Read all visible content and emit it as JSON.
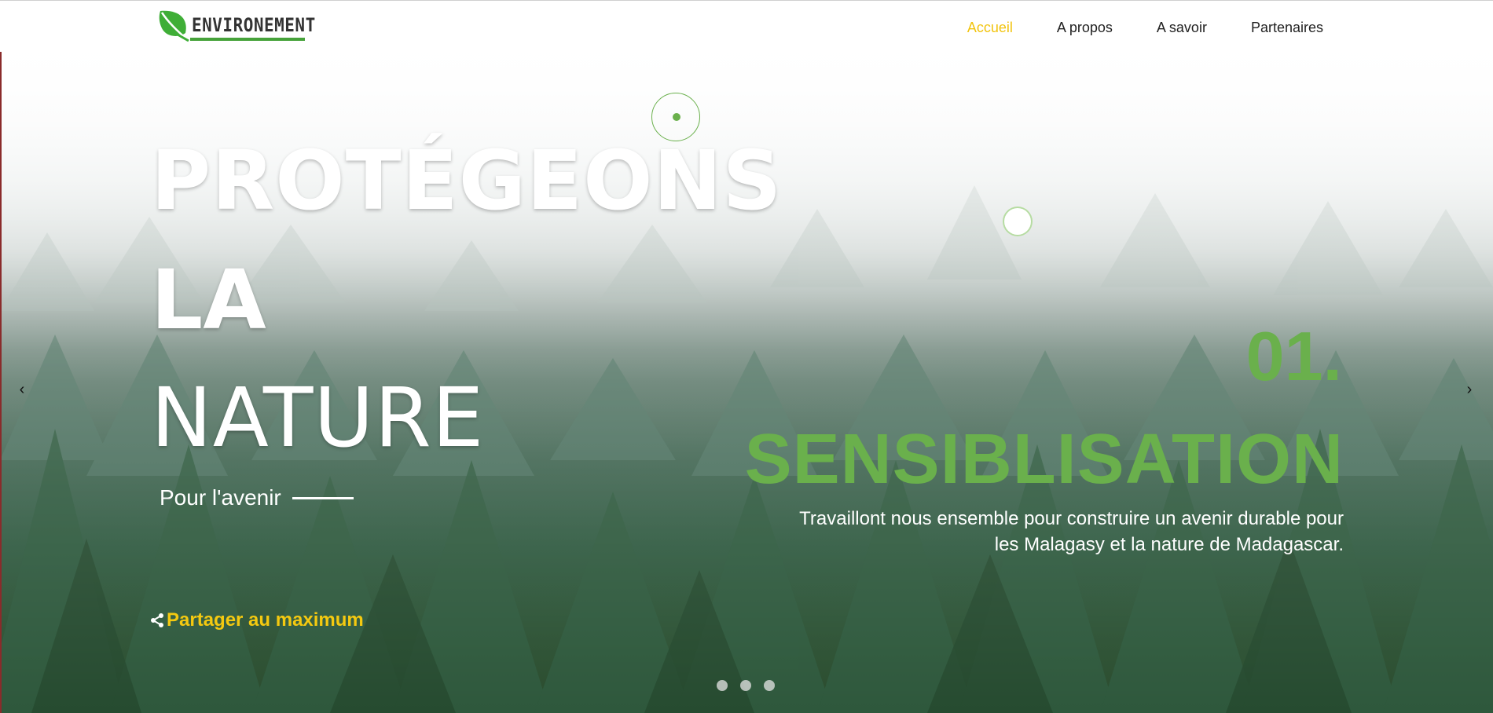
{
  "logo": {
    "text": "ENVIRONEMENT",
    "icon": "leaf-icon",
    "color": "#46a23a"
  },
  "nav": {
    "items": [
      {
        "label": "Accueil",
        "active": true
      },
      {
        "label": "A propos",
        "active": false
      },
      {
        "label": "A savoir",
        "active": false
      },
      {
        "label": "Partenaires",
        "active": false
      }
    ],
    "active_color": "#f2c40f"
  },
  "hero": {
    "line1": "PROTÉGEONS",
    "line2": "LA",
    "line3": "NATURE",
    "tagline": "Pour l'avenir",
    "share_label": "Partager au maximum",
    "share_icon": "share-icon",
    "share_color": "#f4c910"
  },
  "slide": {
    "number": "01.",
    "title": "SENSIBLISATION",
    "description": "Travaillont nous ensemble pour construire un avenir durable pour les Malagasy et la nature de Madagascar.",
    "accent_color": "#6ab04c",
    "prev_icon": "‹",
    "next_icon": "›",
    "indicator_count": 3
  }
}
